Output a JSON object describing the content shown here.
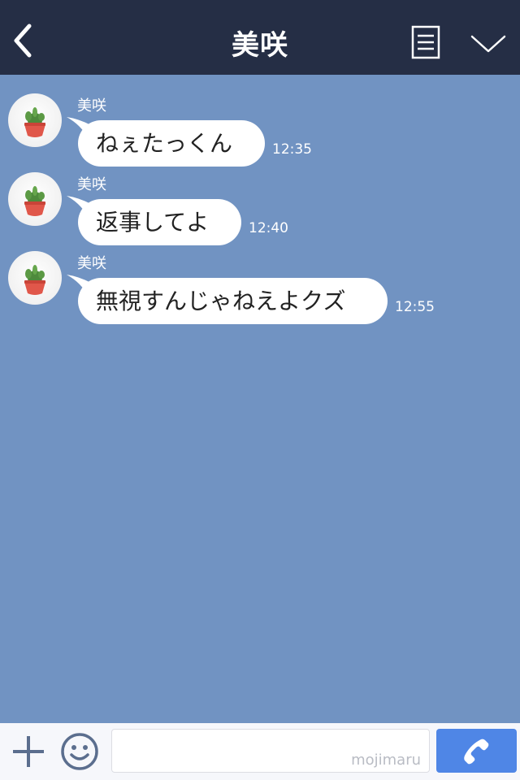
{
  "header": {
    "title": "美咲",
    "back_icon": "chevron-left-icon",
    "menu_icon": "note-list-icon",
    "collapse_icon": "chevron-down-icon"
  },
  "messages": [
    {
      "sender": "美咲",
      "text": "ねぇたっくん",
      "time": "12:35"
    },
    {
      "sender": "美咲",
      "text": "返事してよ",
      "time": "12:40"
    },
    {
      "sender": "美咲",
      "text": "無視すんじゃねえよクズ",
      "time": "12:55"
    }
  ],
  "footer": {
    "plus_icon": "plus-icon",
    "emoji_icon": "smiley-icon",
    "input_value": "",
    "watermark": "mojimaru",
    "call_icon": "phone-icon"
  },
  "colors": {
    "header_bg": "#252e45",
    "chat_bg": "#7193c2",
    "bubble_bg": "#ffffff",
    "call_button": "#4f86e6"
  }
}
